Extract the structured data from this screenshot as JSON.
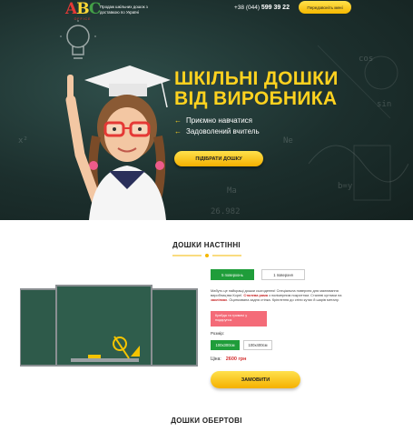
{
  "header": {
    "logo_text": "ABC",
    "logo_sub": "OFFICE",
    "tagline": "Продаж шкільних дошок з доставкою по Україні",
    "phone_prefix": "+38 (044)",
    "phone_number": "599 39 22",
    "callback_label": "Передзвоніть мені"
  },
  "hero": {
    "title_line1": "ШКІЛЬНІ ДОШКИ",
    "title_line2": "ВІД ВИРОБНИКА",
    "bullets": [
      "Приємно навчатися",
      "Задоволений вчитель"
    ],
    "cta_label": "ПІДІБРАТИ ДОШКУ",
    "chalk_texts": [
      "cos",
      "sin",
      "Ne",
      "26.982",
      "Ma",
      "b=y",
      "x²"
    ]
  },
  "product": {
    "section_title": "ДОШКИ НАСТІННІ",
    "tabs": [
      "5 поверхонь",
      "1 поверхня"
    ],
    "active_tab": 0,
    "description_parts": [
      "Мабуть це найкращі дошки сьогодення! Спеціальна поверхня для малювання виробництва Кореї. ",
      "Сталева рама",
      " з полімерним покриттям. Сталеві кутники на ",
      "закліпках",
      ". Оцинкована задня стінка. Кріплення до стіни кутах й шарів металу."
    ],
    "badge": "Крейда та тримачі у подарунок",
    "size_label": "Розмір:",
    "sizes": [
      "100х300см",
      "100х400см"
    ],
    "active_size": 0,
    "price_label": "Ціна:",
    "price_value": "2600 грн",
    "order_label": "ЗАМОВИТИ"
  },
  "next_section": {
    "title": "ДОШКИ ОБЕРТОВІ"
  },
  "colors": {
    "hero_bg": "#1c2f2d",
    "accent_yellow": "#ffd21f",
    "active_green": "#1f9d3a",
    "price_red": "#d32f2f",
    "badge_pink": "#f46b78"
  }
}
